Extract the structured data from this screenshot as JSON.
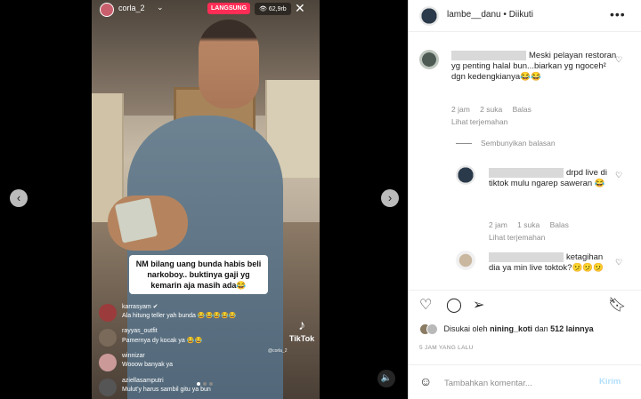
{
  "live": {
    "username": "corla_2",
    "badge": "LANGSUNG",
    "viewers": "62,9rb",
    "caption": "NM bilang uang bunda habis beli narkoboy.. buktinya gaji yg kemarin aja masih ada😂",
    "comments": [
      {
        "user": "karrasyam ✔",
        "text": "Ala hitung teller yah bunda 😂😂😂😂😂",
        "color": "#9c3b3b"
      },
      {
        "user": "rayyas_outfit",
        "text": "Pamernya dy kocak ya 😂😂",
        "color": "#7a6a5a"
      },
      {
        "user": "winnizar",
        "text": "Wooow banyak ya",
        "color": "#c99"
      },
      {
        "user": "aziellasamputri",
        "text": "Mulut'y harus sambil gitu ya bun",
        "color": "#555"
      }
    ],
    "tiktok": "TikTok",
    "tiktok_id": "@corla_2"
  },
  "post": {
    "author": "lambe__danu",
    "dot": "•",
    "follow_status": "Diikuti",
    "more": "•••"
  },
  "comments": [
    {
      "text": "Meski pelayan restoran yg penting halal bun...biarkan yg ngoceh² dgn kedengkianya😂😂",
      "time": "2 jam",
      "likes": "2 suka",
      "reply": "Balas",
      "translate": "Lihat terjemahan"
    },
    {
      "hide_replies": "Sembunyikan balasan"
    },
    {
      "text": "drpd live di tiktok mulu ngarep saweran 😂",
      "time": "2 jam",
      "likes": "1 suka",
      "reply": "Balas",
      "translate": "Lihat terjemahan"
    },
    {
      "text": "ketagihan dia ya min live toktok?🫤🫤🫤"
    }
  ],
  "likes_line": {
    "prefix": "Disukai oleh",
    "user": "nining_koti",
    "middle": "dan",
    "count": "512 lainnya"
  },
  "time_ago": "5 JAM YANG LALU",
  "add_comment": {
    "placeholder": "Tambahkan komentar...",
    "post_label": "Kirim"
  },
  "colors": {
    "post_button": "#b2dffc",
    "live_badge": "#ff2d55"
  }
}
